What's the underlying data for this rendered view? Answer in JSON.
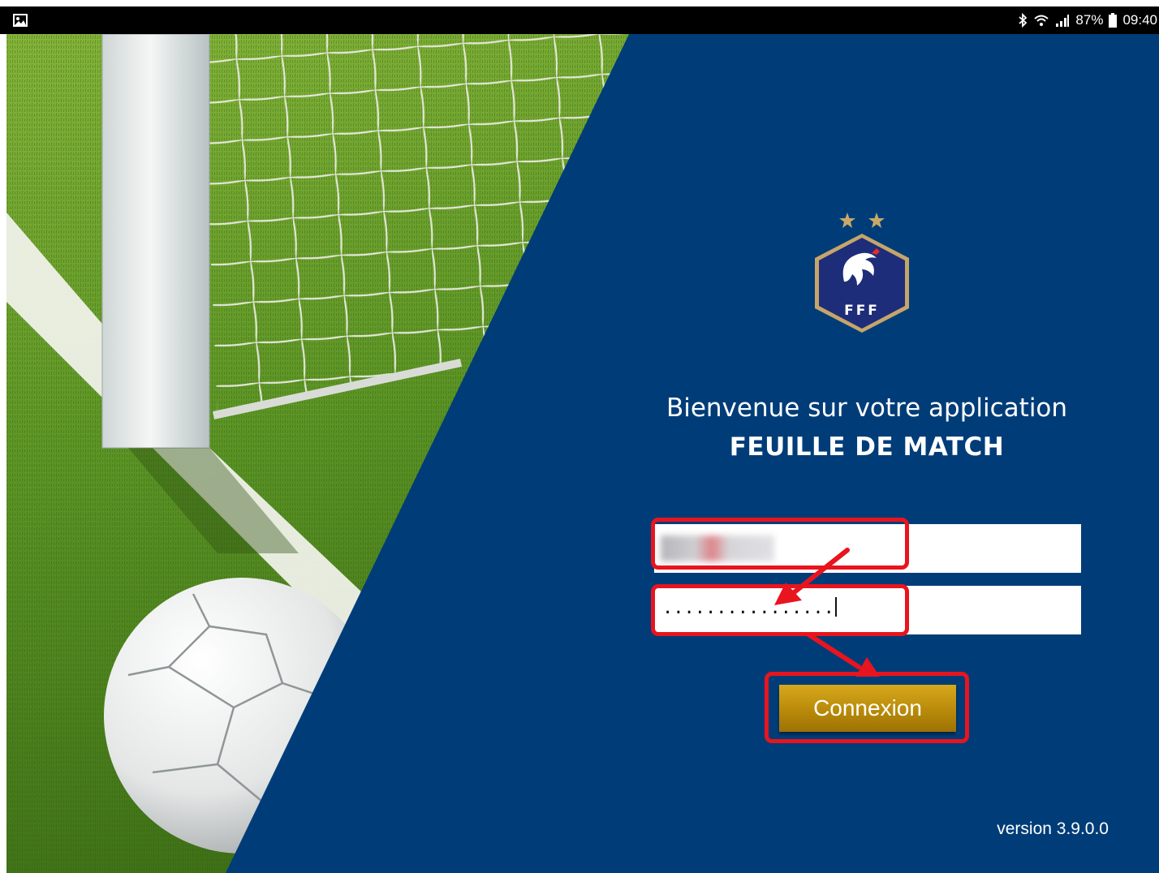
{
  "status_bar": {
    "left_icons": [
      "gallery-icon"
    ],
    "right_icons": [
      "bluetooth-icon",
      "wifi-icon",
      "signal-icon",
      "battery-icon"
    ],
    "battery": "87%",
    "time": "09:40"
  },
  "colors": {
    "panel_blue": "#003d78",
    "button_gold": "#b98a0a",
    "annotation_red": "#e8141e",
    "turf_green": "#5f9a25"
  },
  "logo": {
    "text": "FFF",
    "stars": 2,
    "icon": "rooster-crest-icon"
  },
  "welcome": {
    "line1": "Bienvenue sur votre application",
    "line2": "FEUILLE DE MATCH"
  },
  "login": {
    "username_value": "",
    "password_mask": "................",
    "connect_label": "Connexion"
  },
  "version": "version 3.9.0.0"
}
